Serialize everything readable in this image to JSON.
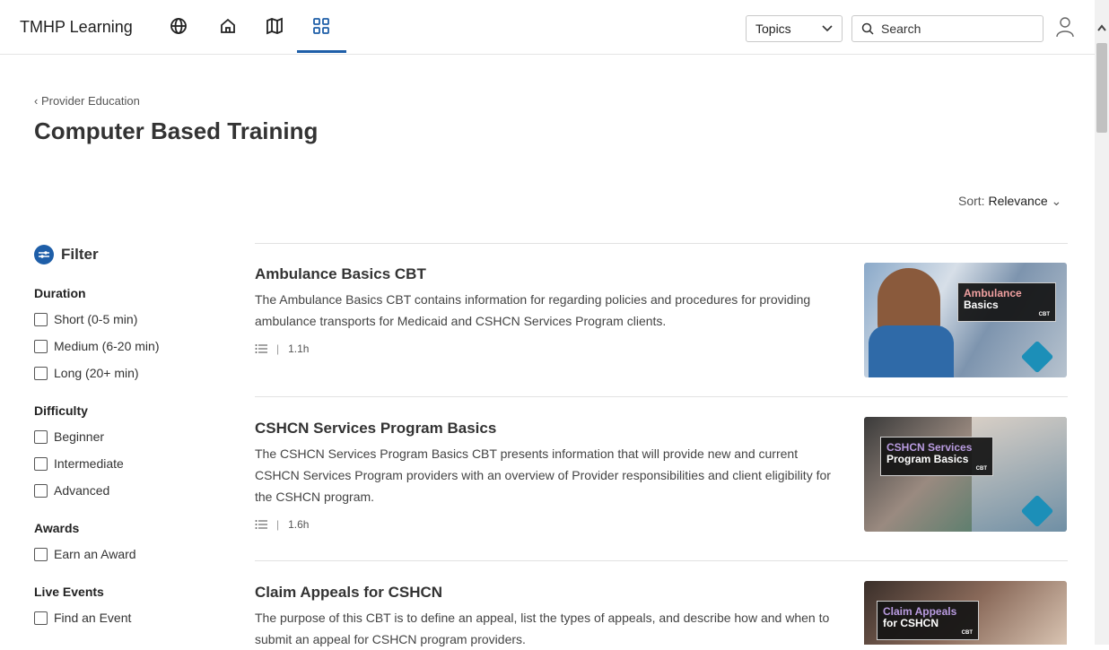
{
  "nav": {
    "brand": "TMHP Learning",
    "icons": [
      "globe-icon",
      "home-icon",
      "map-icon",
      "grid-icon"
    ],
    "topics_label": "Topics",
    "search_placeholder": "Search",
    "accent": "#1e5ea8"
  },
  "breadcrumb": "Provider Education",
  "page_title": "Computer Based Training",
  "sort": {
    "label": "Sort:",
    "value": "Relevance"
  },
  "filter": {
    "title": "Filter",
    "groups": [
      {
        "title": "Duration",
        "options": [
          "Short (0-5 min)",
          "Medium (6-20 min)",
          "Long (20+ min)"
        ]
      },
      {
        "title": "Difficulty",
        "options": [
          "Beginner",
          "Intermediate",
          "Advanced"
        ]
      },
      {
        "title": "Awards",
        "options": [
          "Earn an Award"
        ]
      },
      {
        "title": "Live Events",
        "options": [
          "Find an Event"
        ]
      }
    ]
  },
  "courses": [
    {
      "title": "Ambulance Basics CBT",
      "description": "The Ambulance Basics CBT contains information for regarding policies and procedures for providing ambulance transports for Medicaid and CSHCN Services Program clients.",
      "duration": "1.1h",
      "thumb_line1": "Ambulance",
      "thumb_line2": "Basics",
      "thumb_tag": "CBT"
    },
    {
      "title": "CSHCN Services Program Basics",
      "description": "The CSHCN Services Program Basics CBT presents information that will provide new and current CSHCN Services Program providers with an overview of Provider responsibilities and client eligibility for the CSHCN program.",
      "duration": "1.6h",
      "thumb_line1": "CSHCN Services",
      "thumb_line2": "Program Basics",
      "thumb_tag": "CBT"
    },
    {
      "title": "Claim Appeals for CSHCN",
      "description": "The purpose of this CBT is to define an appeal, list the types of appeals, and describe how and when to submit an appeal for CSHCN program providers.",
      "duration": "",
      "thumb_line1": "Claim Appeals",
      "thumb_line2": "for CSHCN",
      "thumb_tag": "CBT"
    }
  ]
}
